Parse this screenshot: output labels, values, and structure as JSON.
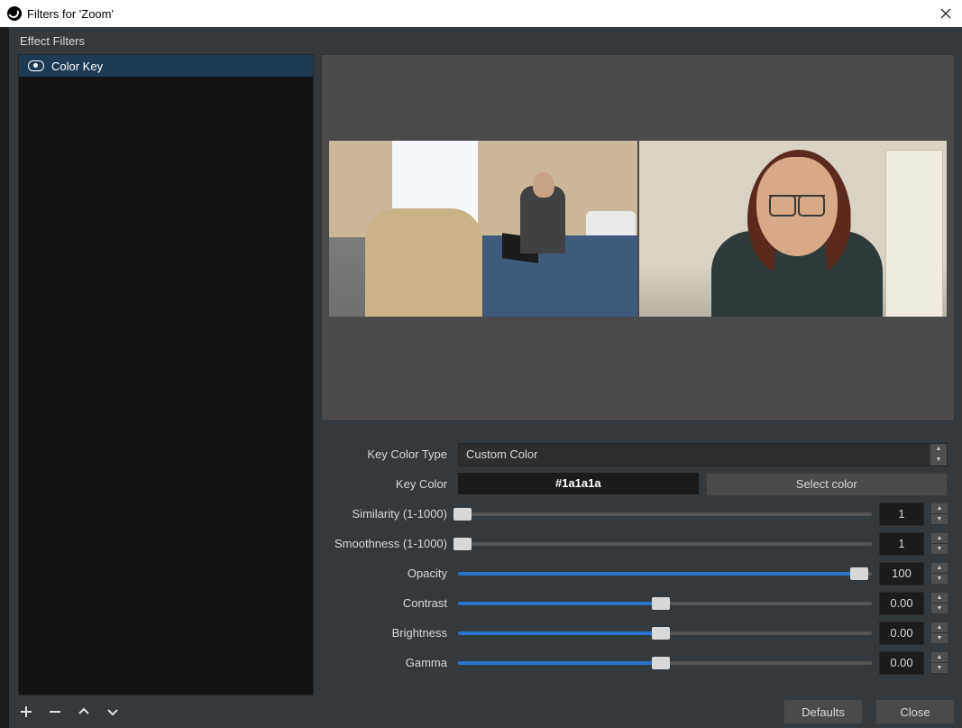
{
  "window": {
    "title": "Filters for 'Zoom'"
  },
  "sidebar": {
    "heading": "Effect Filters",
    "items": [
      {
        "label": "Color Key"
      }
    ]
  },
  "controls": {
    "key_color_type": {
      "label": "Key Color Type",
      "value": "Custom Color"
    },
    "key_color": {
      "label": "Key Color",
      "hex": "#1a1a1a",
      "select_button": "Select color"
    },
    "similarity": {
      "label": "Similarity (1-1000)",
      "value": "1",
      "min": 1,
      "max": 1000,
      "pct": 0
    },
    "smoothness": {
      "label": "Smoothness (1-1000)",
      "value": "1",
      "min": 1,
      "max": 1000,
      "pct": 0
    },
    "opacity": {
      "label": "Opacity",
      "value": "100",
      "pct": 97
    },
    "contrast": {
      "label": "Contrast",
      "value": "0.00",
      "pct": 49
    },
    "brightness": {
      "label": "Brightness",
      "value": "0.00",
      "pct": 49
    },
    "gamma": {
      "label": "Gamma",
      "value": "0.00",
      "pct": 49
    }
  },
  "buttons": {
    "defaults": "Defaults",
    "close": "Close"
  }
}
